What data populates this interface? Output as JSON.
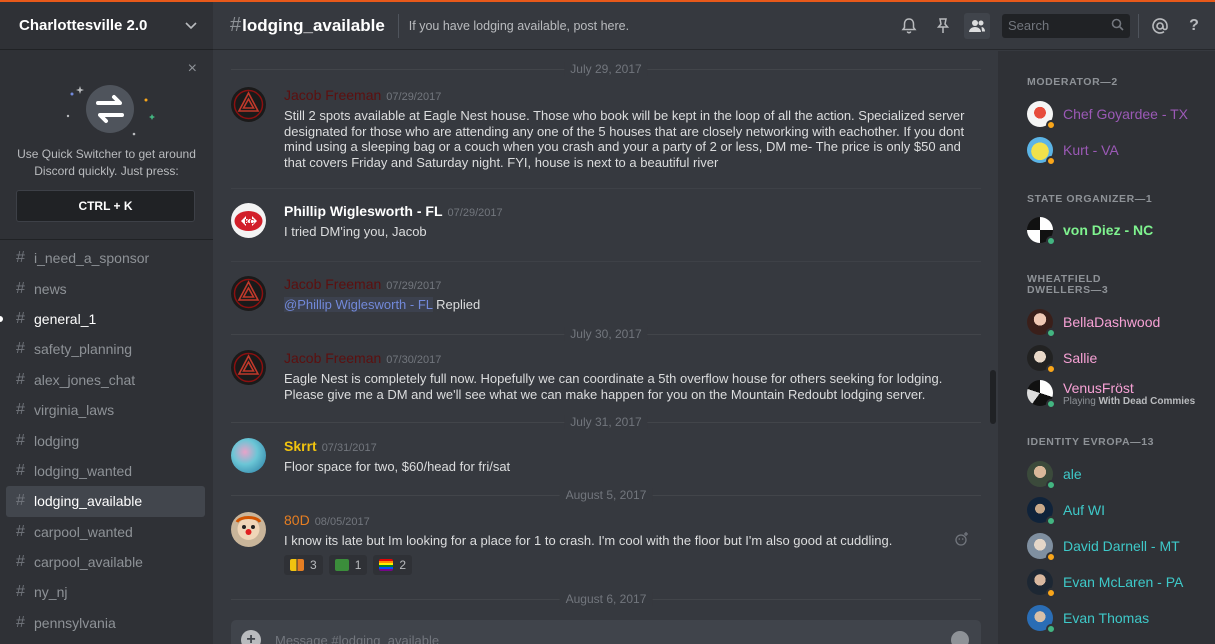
{
  "guild": {
    "name": "Charlottesville 2.0"
  },
  "quick_switcher": {
    "text_line1": "Use Quick Switcher to get around",
    "text_line2": "Discord quickly. Just press:",
    "shortcut": "CTRL + K",
    "close": "×"
  },
  "channels": [
    {
      "name": "i_need_a_sponsor",
      "state": "normal"
    },
    {
      "name": "news",
      "state": "normal"
    },
    {
      "name": "general_1",
      "state": "unread"
    },
    {
      "name": "safety_planning",
      "state": "normal"
    },
    {
      "name": "alex_jones_chat",
      "state": "normal"
    },
    {
      "name": "virginia_laws",
      "state": "normal"
    },
    {
      "name": "lodging",
      "state": "normal"
    },
    {
      "name": "lodging_wanted",
      "state": "normal"
    },
    {
      "name": "lodging_available",
      "state": "active"
    },
    {
      "name": "carpool_wanted",
      "state": "normal"
    },
    {
      "name": "carpool_available",
      "state": "normal"
    },
    {
      "name": "ny_nj",
      "state": "normal"
    },
    {
      "name": "pennsylvania",
      "state": "normal"
    }
  ],
  "header": {
    "hash": "#",
    "channel": "lodging_available",
    "topic": "If you have lodging available, post here.",
    "search_placeholder": "Search",
    "help": "?"
  },
  "dividers": [
    "July 29, 2017",
    "July 30, 2017",
    "July 31, 2017",
    "August 5, 2017",
    "August 6, 2017"
  ],
  "messages": [
    {
      "author": "Jacob Freeman",
      "timestamp": "07/29/2017",
      "text": "Still 2 spots available at Eagle Nest house. Those who book will be kept in the loop of all the action. Specialized server designated for those who are attending any one of the 5 houses that are closely networking with eachother. If you dont mind using a sleeping bag or a couch when you crash and your a party of 2 or less, DM me- The price is only $50 and that covers Friday and Saturday night. FYI, house is next to a beautiful river"
    },
    {
      "author": "Phillip Wiglesworth - FL",
      "timestamp": "07/29/2017",
      "text": "I tried DM'ing you, Jacob"
    },
    {
      "author": "Jacob Freeman",
      "timestamp": "07/29/2017",
      "mention": "@Phillip Wiglesworth - FL",
      "text": " Replied"
    },
    {
      "author": "Jacob Freeman",
      "timestamp": "07/30/2017",
      "text": "Eagle Nest is completely full now. Hopefully we can coordinate a 5th overflow house for others seeking for lodging. Please give me a DM and we'll see what we can make happen for you on the Mountain Redoubt lodging server."
    },
    {
      "author": "Skrrt",
      "timestamp": "07/31/2017",
      "text": "Floor space for two, $60/head for fri/sat"
    },
    {
      "author": "80D",
      "timestamp": "08/05/2017",
      "text": "I know its late but Im looking for a place for 1 to crash. I'm cool with the floor but I'm also good at cuddling.",
      "reactions": [
        {
          "emoji": "people-icon",
          "count": "3"
        },
        {
          "emoji": "frog-icon",
          "count": "1"
        },
        {
          "emoji": "rainbow-flag-icon",
          "count": "2"
        }
      ]
    }
  ],
  "composer": {
    "placeholder": "Message #lodging_available",
    "plus": "+"
  },
  "members": {
    "roles": [
      {
        "title": "MODERATOR—2"
      },
      {
        "title": "STATE ORGANIZER—1"
      },
      {
        "title": "WHEATFIELD DWELLERS—3"
      },
      {
        "title": "IDENTITY EVROPA—13"
      }
    ],
    "list": [
      {
        "name": "Chef Goyardee - TX",
        "color": "#9b59b6",
        "status": "#faa61a"
      },
      {
        "name": "Kurt - VA",
        "color": "#9b59b6",
        "status": "#faa61a"
      },
      {
        "name": "von Diez - NC",
        "color": "#7ff38f",
        "status": "#43b581"
      },
      {
        "name": "BellaDashwood",
        "color": "#f7a1d5",
        "status": "#43b581"
      },
      {
        "name": "Sallie",
        "color": "#f7a1d5",
        "status": "#faa61a"
      },
      {
        "name": "VenusFröst",
        "color": "#f7a1d5",
        "status": "#43b581",
        "activity_prefix": "Playing ",
        "activity": "With Dead Commies"
      },
      {
        "name": "ale",
        "color": "#3ec9c9",
        "status": "#43b581"
      },
      {
        "name": "Auf WI",
        "color": "#3ec9c9",
        "status": "#43b581"
      },
      {
        "name": "David Darnell - MT",
        "color": "#3ec9c9",
        "status": "#faa61a"
      },
      {
        "name": "Evan McLaren - PA",
        "color": "#3ec9c9",
        "status": "#faa61a"
      },
      {
        "name": "Evan Thomas",
        "color": "#3ec9c9",
        "status": "#43b581"
      }
    ]
  },
  "colors": {
    "accent_line": "#e8591a",
    "author_dark": "#5c0f0f",
    "author_gold": "#f1c40f",
    "author_orange": "#e67e22",
    "mention": "#7289da"
  }
}
